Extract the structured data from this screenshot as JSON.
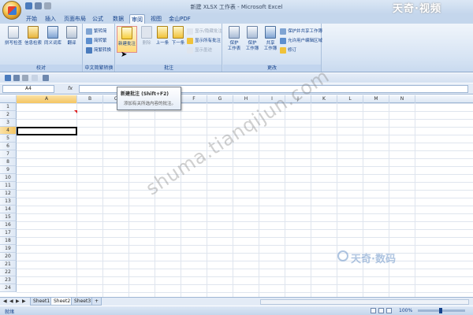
{
  "window": {
    "title": "新建 XLSX 工作表 - Microsoft Excel",
    "watermark_top": "天奇·视频"
  },
  "tabs": [
    "开始",
    "插入",
    "页面布局",
    "公式",
    "数据",
    "审阅",
    "视图",
    "金山PDF"
  ],
  "active_tab": "审阅",
  "ribbon": {
    "proofing": {
      "label": "校对",
      "spelling": "拼写检查",
      "research": "信息检索",
      "thesaurus": "同义词库",
      "translate": "翻译"
    },
    "chinese": {
      "label": "中文简繁转换",
      "to_simplified": "繁转简",
      "to_traditional": "简转繁",
      "convert": "简繁转换"
    },
    "comments": {
      "label": "批注",
      "new_comment": "新建批注",
      "delete": "删除",
      "previous": "上一条",
      "next": "下一条",
      "show_hide": "显示/隐藏批注",
      "show_all": "显示所有批注",
      "show_ink": "显示墨迹"
    },
    "changes": {
      "label": "更改",
      "protect_sheet": "保护\n工作表",
      "protect_workbook": "保护\n工作簿",
      "share_workbook": "共享\n工作簿",
      "protect_share": "保护并共享工作簿",
      "allow_edit": "允许用户编辑区域",
      "track": "修订"
    }
  },
  "tooltip": {
    "title": "新建批注 (Shift+F2)",
    "body": "添加有关所选内容的批注。"
  },
  "formula_bar": {
    "name_box": "A4",
    "fx": "fx",
    "value": ""
  },
  "grid": {
    "columns": [
      "A",
      "B",
      "C",
      "D",
      "E",
      "F",
      "G",
      "H",
      "I",
      "J",
      "K",
      "L",
      "M",
      "N"
    ],
    "rows": [
      "1",
      "2",
      "3",
      "4",
      "5",
      "6",
      "7",
      "8",
      "9",
      "10",
      "11",
      "12",
      "13",
      "14",
      "15",
      "16",
      "17",
      "18",
      "19",
      "20",
      "21",
      "22",
      "23",
      "24"
    ],
    "selected_column": "A",
    "selected_row": "4"
  },
  "watermarks": {
    "diagonal": "shuma.tianqijun.com",
    "brand": "天奇·数码"
  },
  "sheets": [
    "Sheet1",
    "Sheet2",
    "Sheet3"
  ],
  "active_sheet": "Sheet2",
  "status": {
    "ready": "就绪",
    "zoom": "100%"
  }
}
